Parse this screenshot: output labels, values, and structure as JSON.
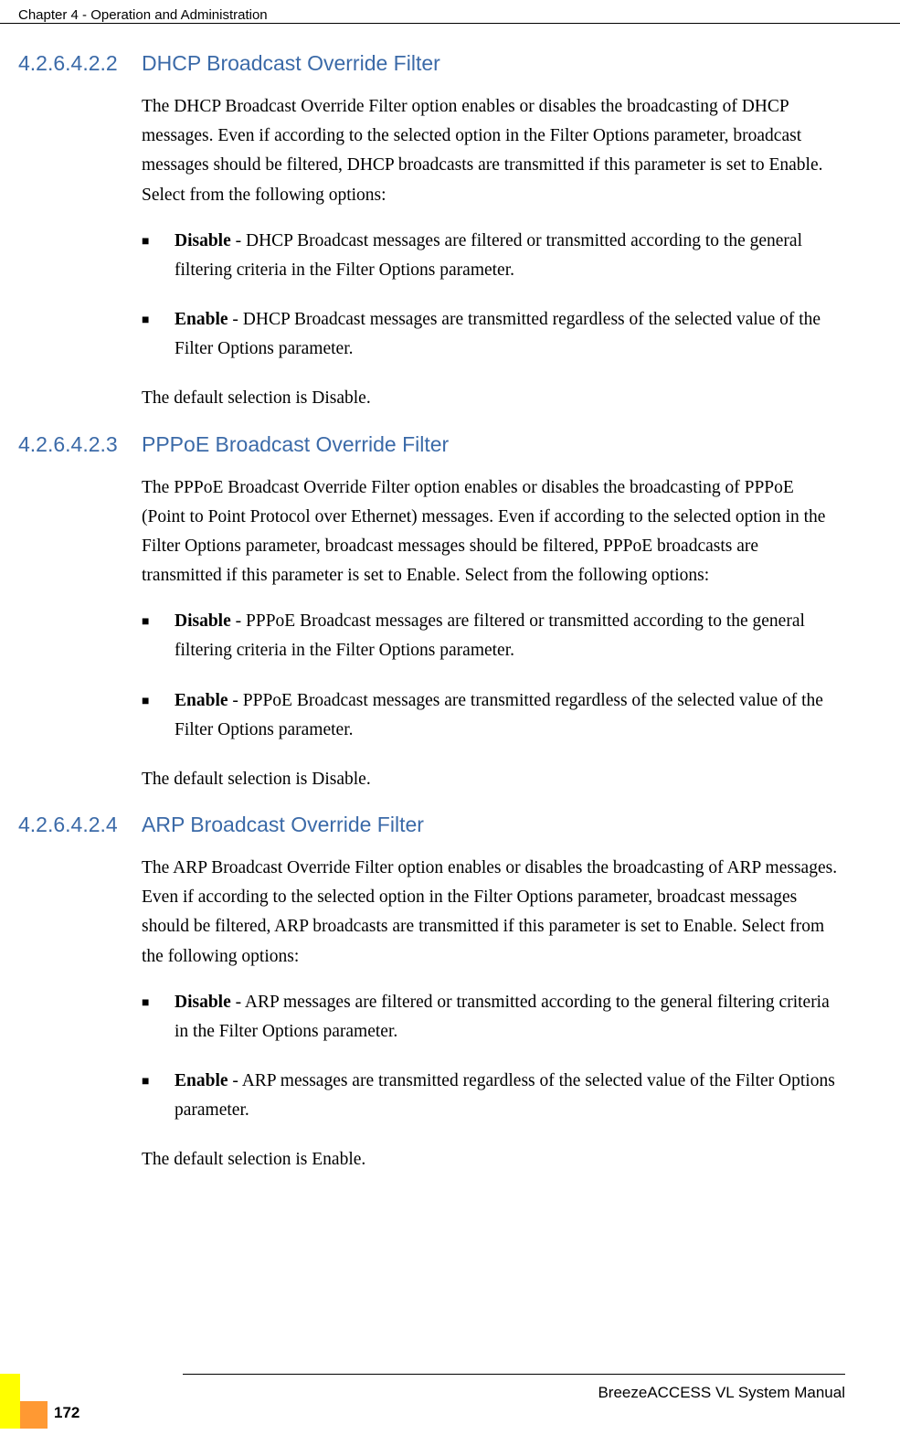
{
  "header": {
    "chapter": "Chapter 4 - Operation and Administration"
  },
  "sections": [
    {
      "number": "4.2.6.4.2.2",
      "title": "DHCP Broadcast Override Filter",
      "intro": "The DHCP Broadcast Override Filter option enables or disables the broadcasting of DHCP messages. Even if according to the selected option in the Filter Options parameter, broadcast messages should be filtered, DHCP broadcasts are transmitted if this parameter is set to Enable. Select from the following options:",
      "bullets": [
        {
          "bold": "Disable",
          "text": " - DHCP Broadcast messages are filtered or transmitted according to the general filtering criteria in the Filter Options parameter."
        },
        {
          "bold": "Enable",
          "text": " - DHCP Broadcast messages are transmitted regardless of the selected value of the Filter Options parameter."
        }
      ],
      "outro": "The default selection is Disable."
    },
    {
      "number": "4.2.6.4.2.3",
      "title": "PPPoE Broadcast Override Filter",
      "intro": "The PPPoE Broadcast Override Filter option enables or disables the broadcasting of PPPoE (Point to Point Protocol over Ethernet) messages. Even if according to the selected option in the Filter Options parameter, broadcast messages should be filtered, PPPoE broadcasts are transmitted if this parameter is set to Enable. Select from the following options:",
      "bullets": [
        {
          "bold": "Disable",
          "text": " - PPPoE Broadcast messages are filtered or transmitted according to the general filtering criteria in the Filter Options parameter."
        },
        {
          "bold": "Enable",
          "text": " - PPPoE Broadcast messages are transmitted regardless of the selected value of the Filter Options parameter."
        }
      ],
      "outro": "The default selection is Disable."
    },
    {
      "number": "4.2.6.4.2.4",
      "title": "ARP Broadcast Override Filter",
      "intro": "The ARP Broadcast Override Filter option enables or disables the broadcasting of ARP messages. Even if according to the selected option in the Filter Options parameter, broadcast messages should be filtered, ARP broadcasts are transmitted if this parameter is set to Enable. Select from the following options:",
      "bullets": [
        {
          "bold": "Disable",
          "text": " - ARP messages are filtered or transmitted according to the general filtering criteria in the Filter Options parameter."
        },
        {
          "bold": "Enable",
          "text": " - ARP messages are transmitted regardless of the selected value of the Filter Options parameter."
        }
      ],
      "outro": "The default selection is Enable."
    }
  ],
  "footer": {
    "manual": "BreezeACCESS VL System Manual",
    "page": "172"
  }
}
